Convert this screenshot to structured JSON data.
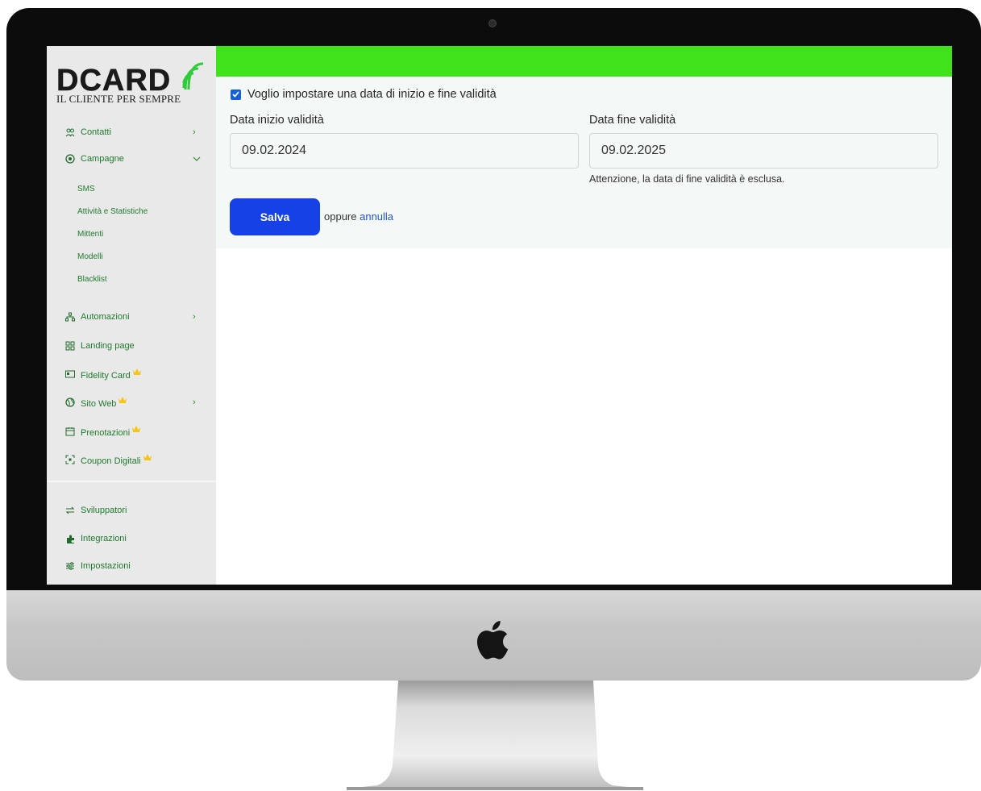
{
  "logo": {
    "name": "DCARD",
    "tagline": "IL CLIENTE PER SEMPRE"
  },
  "sidebar": {
    "items": [
      {
        "label": "Contatti",
        "icon": "users-icon",
        "chevron": ">"
      },
      {
        "label": "Campagne",
        "icon": "megaphone-icon",
        "chevron": "v"
      },
      {
        "label": "Automazioni",
        "icon": "hierarchy-icon",
        "chevron": ">"
      },
      {
        "label": "Landing page",
        "icon": "grid-icon"
      },
      {
        "label": "Fidelity Card",
        "icon": "card-icon",
        "premium": true
      },
      {
        "label": "Sito Web",
        "icon": "globe-icon",
        "premium": true,
        "chevron": ">"
      },
      {
        "label": "Prenotazioni",
        "icon": "calendar-icon",
        "premium": true
      },
      {
        "label": "Coupon Digitali",
        "icon": "coupon-icon",
        "premium": true
      },
      {
        "label": "Sviluppatori",
        "icon": "arrows-icon"
      },
      {
        "label": "Integrazioni",
        "icon": "puzzle-icon"
      },
      {
        "label": "Impostazioni",
        "icon": "sliders-icon"
      }
    ],
    "campagne_sub": [
      "SMS",
      "Attività e Statistiche",
      "Mittenti",
      "Modelli",
      "Blacklist"
    ]
  },
  "form": {
    "checkbox_label": "Voglio impostare una data di inizio e fine validità",
    "checkbox_checked": true,
    "start_label": "Data inizio validità",
    "start_value": "09.02.2024",
    "end_label": "Data fine validità",
    "end_value": "09.02.2025",
    "note": "Attenzione, la data di fine validità è esclusa.",
    "save_label": "Salva",
    "or_text": "oppure",
    "cancel_label": "annulla"
  },
  "colors": {
    "topbar": "#40e21a",
    "primary_button": "#1641e6",
    "sidebar_text": "#1f7a2c",
    "link": "#1f55d6"
  }
}
